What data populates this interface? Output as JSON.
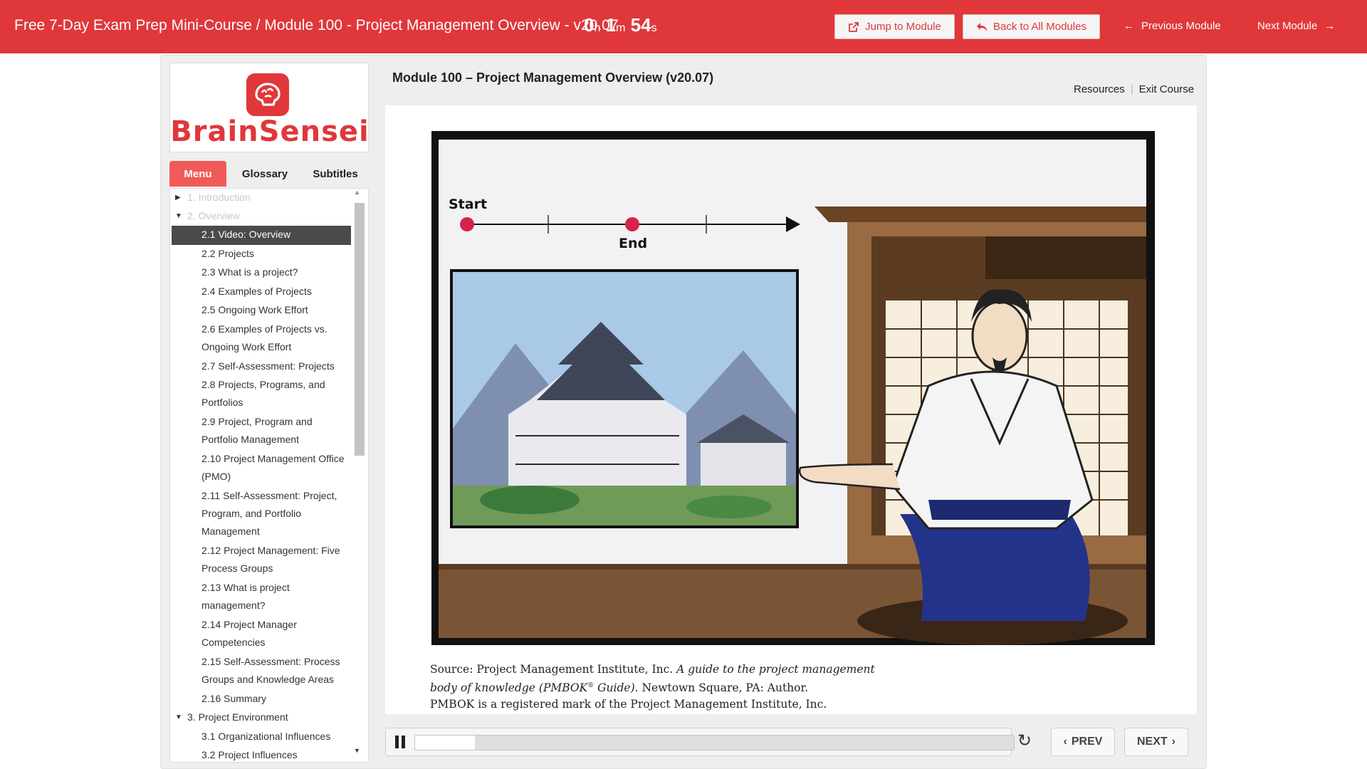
{
  "header": {
    "breadcrumb": "Free 7-Day Exam Prep Mini-Course / Module 100 - Project Management Overview - v20.07",
    "timer": {
      "h": "0",
      "h_unit": "h",
      "m": "1",
      "m_unit": "m",
      "s": "54",
      "s_unit": "s"
    },
    "jump_label": "Jump to Module",
    "back_label": "Back to All Modules",
    "prev_label": "Previous Module",
    "next_label": "Next Module"
  },
  "brand": {
    "logo_text": "BrainSensei",
    "accent": "#e0373a"
  },
  "tabs": [
    {
      "label": "Menu",
      "active": true
    },
    {
      "label": "Glossary",
      "active": false
    },
    {
      "label": "Subtitles",
      "active": false
    }
  ],
  "menu": {
    "items": [
      {
        "label": "1. Introduction"
      },
      {
        "label": "2. Overview"
      },
      {
        "label": "2.1 Video: Overview"
      },
      {
        "label": "2.2 Projects"
      },
      {
        "label": "2.3 What is a project?"
      },
      {
        "label": "2.4 Examples of Projects"
      },
      {
        "label": "2.5 Ongoing Work Effort"
      },
      {
        "label": "2.6 Examples of Projects vs. Ongoing Work Effort"
      },
      {
        "label": "2.7 Self-Assessment: Projects"
      },
      {
        "label": "2.8 Projects, Programs, and Portfolios"
      },
      {
        "label": "2.9 Project, Program and Portfolio Management"
      },
      {
        "label": "2.10 Project Management Office (PMO)"
      },
      {
        "label": "2.11 Self-Assessment: Project, Program, and Portfolio Management"
      },
      {
        "label": "2.12 Project Management: Five Process Groups"
      },
      {
        "label": "2.13 What is project management?"
      },
      {
        "label": "2.14 Project Manager Competencies"
      },
      {
        "label": "2.15 Self-Assessment: Process Groups and Knowledge Areas"
      },
      {
        "label": "2.16 Summary"
      },
      {
        "label": "3. Project Environment"
      },
      {
        "label": "3.1 Organizational Influences"
      },
      {
        "label": "3.2 Project Influences"
      }
    ]
  },
  "content": {
    "module_title": "Module 100 – Project Management Overview (v20.07)",
    "resources_label": "Resources",
    "exit_label": "Exit Course",
    "scene": {
      "start_label": "Start",
      "end_label": "End"
    },
    "source_line1_a": "Source: Project Management Institute, Inc. ",
    "source_line1_b": "A guide to the project management",
    "source_line2_a": "body of knowledge (PMBOK",
    "source_reg": "®",
    "source_line2_b": " Guide).",
    "source_line2_c": " Newtown Square, PA: Author.",
    "source_line3": "PMBOK is a registered mark of the Project Management Institute, Inc."
  },
  "player": {
    "progress": 0.1,
    "prev_label": "PREV",
    "next_label": "NEXT"
  }
}
